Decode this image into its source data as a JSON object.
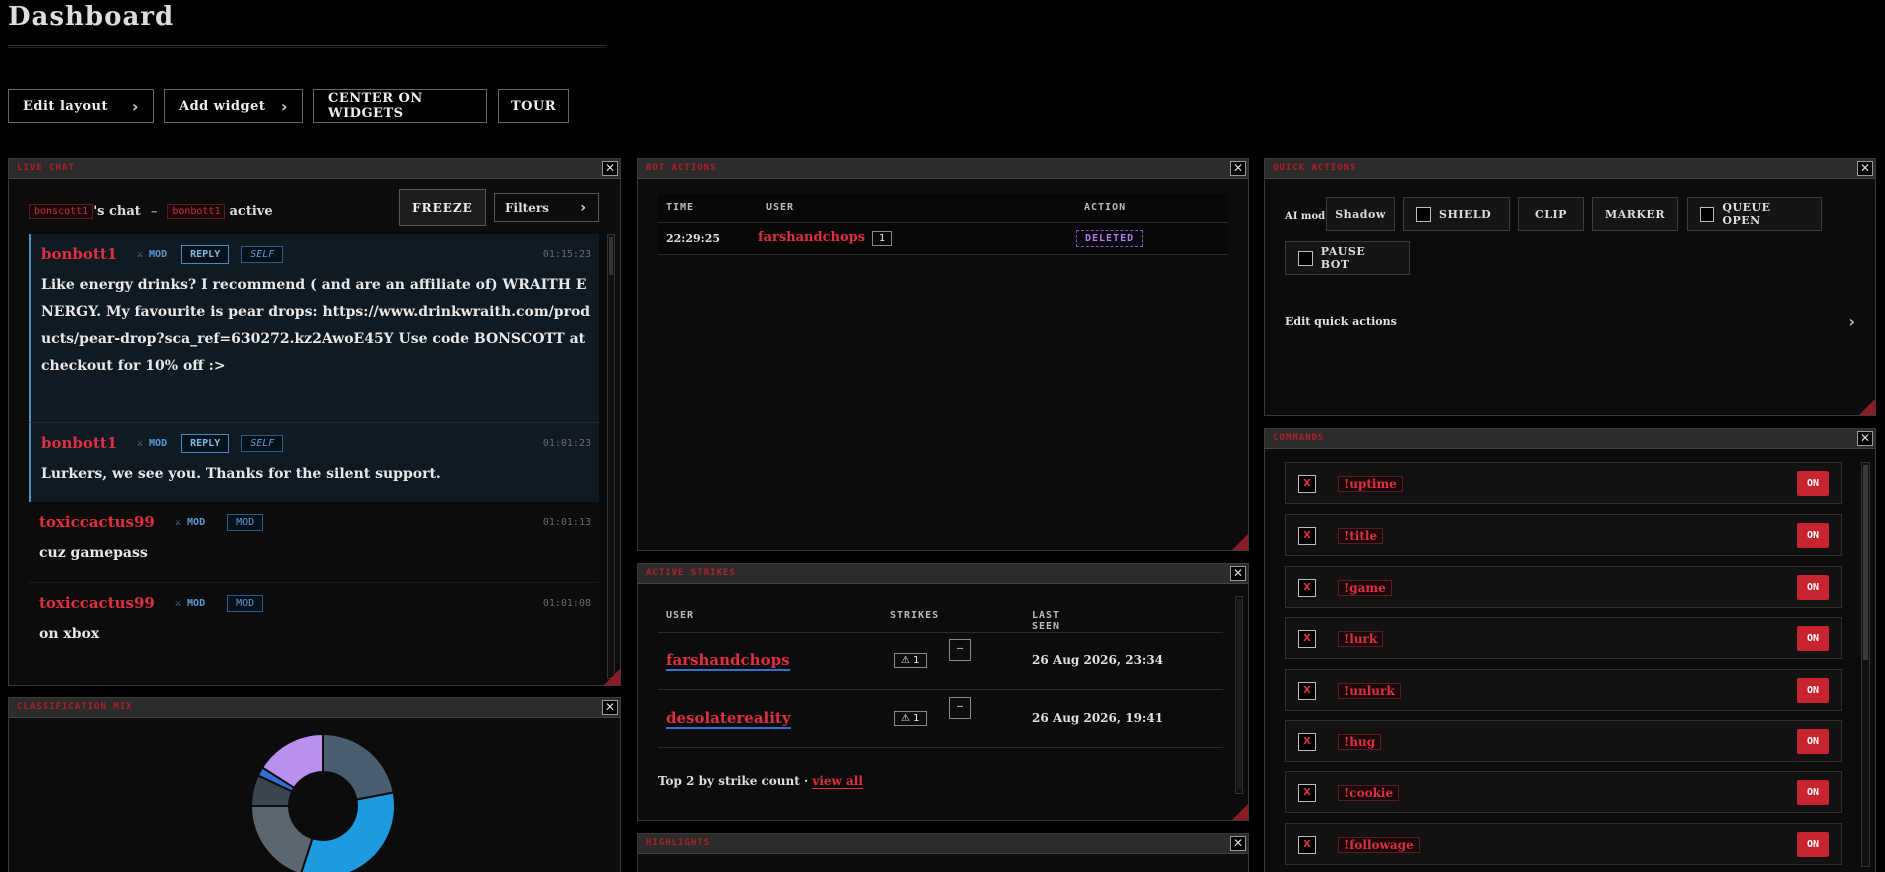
{
  "page": {
    "title": "Dashboard"
  },
  "toolbar": {
    "edit_layout": "Edit layout",
    "add_widget": "Add widget",
    "center": "CENTER ON WIDGETS",
    "tour": "TOUR"
  },
  "live_chat": {
    "title": "LIVE CHAT",
    "channel": "bonscott1",
    "chat_suffix": "'s chat",
    "separator": "–",
    "bot": "bonbott1",
    "active_label": "active",
    "freeze_label": "FREEZE",
    "filters_label": "Filters",
    "messages": [
      {
        "user": "bonbott1",
        "mod": "⚔ MOD",
        "reply": "REPLY",
        "tag": "SELF",
        "time": "01:15:23",
        "text": "Like energy drinks? I recommend ( and are an affiliate of) WRAITH ENERGY. My favourite is pear drops: https://www.drinkwraith.com/products/pear-drop?sca_ref=630272.kz2AwoE45Y Use code BONSCOTT at checkout for 10% off :>"
      },
      {
        "user": "bonbott1",
        "mod": "⚔ MOD",
        "reply": "REPLY",
        "tag": "SELF",
        "time": "01:01:23",
        "text": "Lurkers, we see you. Thanks for the silent support."
      },
      {
        "user": "toxiccactus99",
        "mod": "⚔ MOD",
        "tag": "MOD",
        "time": "01:01:13",
        "text": "cuz gamepass"
      },
      {
        "user": "toxiccactus99",
        "mod": "⚔ MOD",
        "tag": "MOD",
        "time": "01:01:08",
        "text": "on xbox"
      }
    ]
  },
  "bot_actions": {
    "title": "BOT ACTIONS",
    "headers": {
      "time": "TIME",
      "user": "USER",
      "action": "ACTION"
    },
    "rows": [
      {
        "time": "22:29:25",
        "user": "farshandchops",
        "count": "1",
        "action": "DELETED"
      }
    ]
  },
  "active_strikes": {
    "title": "ACTIVE STRIKES",
    "headers": {
      "user": "USER",
      "strikes": "STRIKES",
      "last_seen": "LAST SEEN"
    },
    "rows": [
      {
        "user": "farshandchops",
        "strikes": "⚠ 1",
        "remove": "—",
        "last_seen": "26 Aug 2026, 23:34"
      },
      {
        "user": "desolatereality",
        "strikes": "⚠ 1",
        "remove": "—",
        "last_seen": "26 Aug 2026, 19:41"
      }
    ],
    "footer": "Top 2 by strike count ·",
    "view_all": "view all"
  },
  "classification": {
    "title": "CLASSIFICATION MIX",
    "chart_data": {
      "type": "pie",
      "slices": [
        {
          "value": 22,
          "color": "#4a5d6e"
        },
        {
          "value": 33,
          "color": "#1e9be0"
        },
        {
          "value": 20,
          "color": "#5b6670"
        },
        {
          "value": 7,
          "color": "#3a4550"
        },
        {
          "value": 2,
          "color": "#2f6fd0"
        },
        {
          "value": 16,
          "color": "#b890f0"
        }
      ]
    }
  },
  "highlights": {
    "title": "HIGHLIGHTS"
  },
  "quick_actions": {
    "title": "QUICK ACTIONS",
    "ai_mod": "AI mod",
    "shadow": "Shadow",
    "shield": "SHIELD",
    "clip": "CLIP",
    "marker": "MARKER",
    "queue_open": "QUEUE OPEN",
    "pause_bot": "PAUSE BOT",
    "edit": "Edit quick actions"
  },
  "commands": {
    "title": "COMMANDS",
    "del_icon": "X",
    "items": [
      {
        "name": "!uptime",
        "state": "ON"
      },
      {
        "name": "!title",
        "state": "ON"
      },
      {
        "name": "!game",
        "state": "ON"
      },
      {
        "name": "!lurk",
        "state": "ON"
      },
      {
        "name": "!unlurk",
        "state": "ON"
      },
      {
        "name": "!hug",
        "state": "ON"
      },
      {
        "name": "!cookie",
        "state": "ON"
      },
      {
        "name": "!followage",
        "state": "ON"
      }
    ]
  }
}
